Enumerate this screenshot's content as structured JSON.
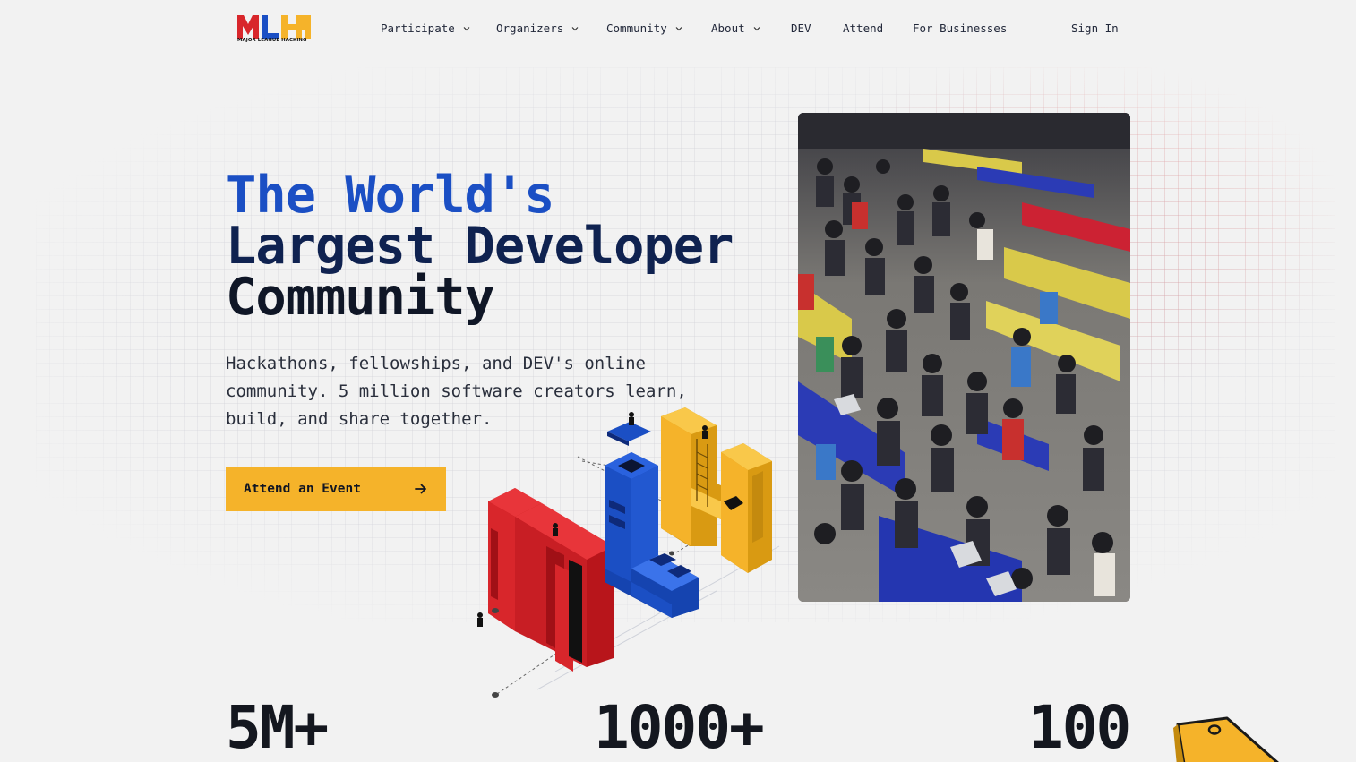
{
  "nav": {
    "logo_text": "MLH",
    "logo_subtext": "MAJOR LEAGUE HACKING",
    "items": [
      {
        "label": "Participate",
        "dropdown": true
      },
      {
        "label": "Organizers",
        "dropdown": true
      },
      {
        "label": "Community",
        "dropdown": true
      },
      {
        "label": "About",
        "dropdown": true
      },
      {
        "label": "DEV",
        "dropdown": false
      },
      {
        "label": "Attend",
        "dropdown": false
      },
      {
        "label": "For Businesses",
        "dropdown": false
      }
    ],
    "sign_in": "Sign In"
  },
  "hero": {
    "title_line1": "The World's",
    "title_line2": "Largest Developer",
    "title_line3": "Community",
    "subtitle": "Hackathons, fellowships, and DEV's online community. 5 million software creators learn, build, and share together.",
    "cta_label": "Attend an Event",
    "cta_icon": "arrow-right-icon"
  },
  "stats": [
    {
      "value": "5M+"
    },
    {
      "value": "1000+"
    },
    {
      "value": "100"
    }
  ],
  "colors": {
    "blue": "#1b4fc4",
    "navy": "#0f2250",
    "red": "#d8262b",
    "yellow": "#f5b32a",
    "background": "#f2f2f2"
  }
}
